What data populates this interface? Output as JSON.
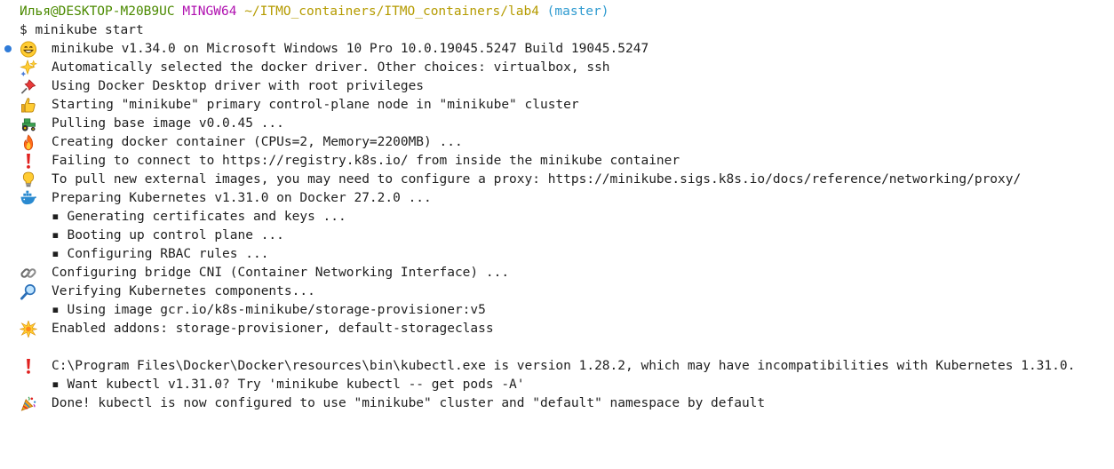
{
  "prompt": {
    "user_host": "Илья@DESKTOP-M20B9UC",
    "shell": "MINGW64",
    "path": "~/ITMO_containers/ITMO_containers/lab4",
    "branch": "(master)",
    "symbol": "$",
    "command": "minikube start"
  },
  "colors": {
    "user_host": "#4b8a00",
    "shell": "#b012b0",
    "path": "#b59b00",
    "branch": "#2f9bd0",
    "marker": "#2f7bd8"
  },
  "lines": [
    {
      "icon": "smile-icon",
      "text": "minikube v1.34.0 on Microsoft Windows 10 Pro 10.0.19045.5247 Build 19045.5247"
    },
    {
      "icon": "sparkles-icon",
      "text": "Automatically selected the docker driver. Other choices: virtualbox, ssh"
    },
    {
      "icon": "pushpin-icon",
      "text": "Using Docker Desktop driver with root privileges"
    },
    {
      "icon": "thumbs-up-icon",
      "text": "Starting \"minikube\" primary control-plane node in \"minikube\" cluster"
    },
    {
      "icon": "tractor-icon",
      "text": "Pulling base image v0.0.45 ..."
    },
    {
      "icon": "fire-icon",
      "text": "Creating docker container (CPUs=2, Memory=2200MB) ..."
    },
    {
      "icon": "exclamation-icon",
      "text": "Failing to connect to https://registry.k8s.io/ from inside the minikube container"
    },
    {
      "icon": "lightbulb-icon",
      "text": "To pull new external images, you may need to configure a proxy: https://minikube.sigs.k8s.io/docs/reference/networking/proxy/"
    },
    {
      "icon": "whale-icon",
      "text": "Preparing Kubernetes v1.31.0 on Docker 27.2.0 ..."
    },
    {
      "sub": "▪ Generating certificates and keys ..."
    },
    {
      "sub": "▪ Booting up control plane ..."
    },
    {
      "sub": "▪ Configuring RBAC rules ..."
    },
    {
      "icon": "link-icon",
      "text": "Configuring bridge CNI (Container Networking Interface) ..."
    },
    {
      "icon": "magnifier-icon",
      "text": "Verifying Kubernetes components..."
    },
    {
      "sub": "▪ Using image gcr.io/k8s-minikube/storage-provisioner:v5"
    },
    {
      "icon": "star-burst-icon",
      "text": "Enabled addons: storage-provisioner, default-storageclass"
    },
    {
      "blank": ""
    },
    {
      "icon": "exclamation-icon",
      "text": "C:\\Program Files\\Docker\\Docker\\resources\\bin\\kubectl.exe is version 1.28.2, which may have incompatibilities with Kubernetes 1.31.0."
    },
    {
      "sub": "▪ Want kubectl v1.31.0? Try 'minikube kubectl -- get pods -A'"
    },
    {
      "icon": "party-icon",
      "text": "Done! kubectl is now configured to use \"minikube\" cluster and \"default\" namespace by default"
    }
  ]
}
